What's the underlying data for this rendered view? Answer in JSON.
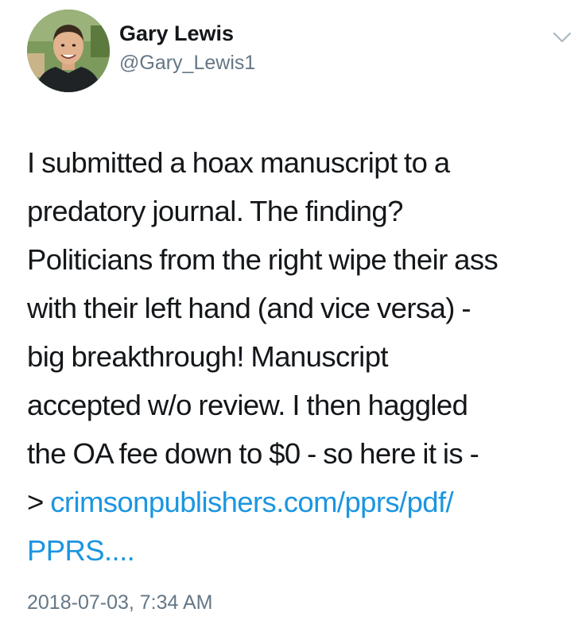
{
  "author": {
    "display_name": "Gary Lewis",
    "handle": "@Gary_Lewis1"
  },
  "tweet": {
    "lines": [
      "I submitted a hoax manuscript to a",
      "predatory journal. The finding?",
      "Politicians from the right wipe their ass",
      "with their left hand (and vice versa) -",
      "big breakthrough! Manuscript",
      "accepted w/o review. I then haggled",
      "the OA fee down to $0 - so here it is -"
    ],
    "arrow_prefix": "> ",
    "link_line1": "crimsonpublishers.com/pprs/pdf/",
    "link_line2": "PPRS...."
  },
  "timestamp": "2018-07-03, 7:34 AM",
  "icons": {
    "avatar": "profile-photo",
    "menu": "chevron-down-icon"
  },
  "colors": {
    "text": "#14171a",
    "secondary": "#657786",
    "link": "#1b95e0"
  }
}
